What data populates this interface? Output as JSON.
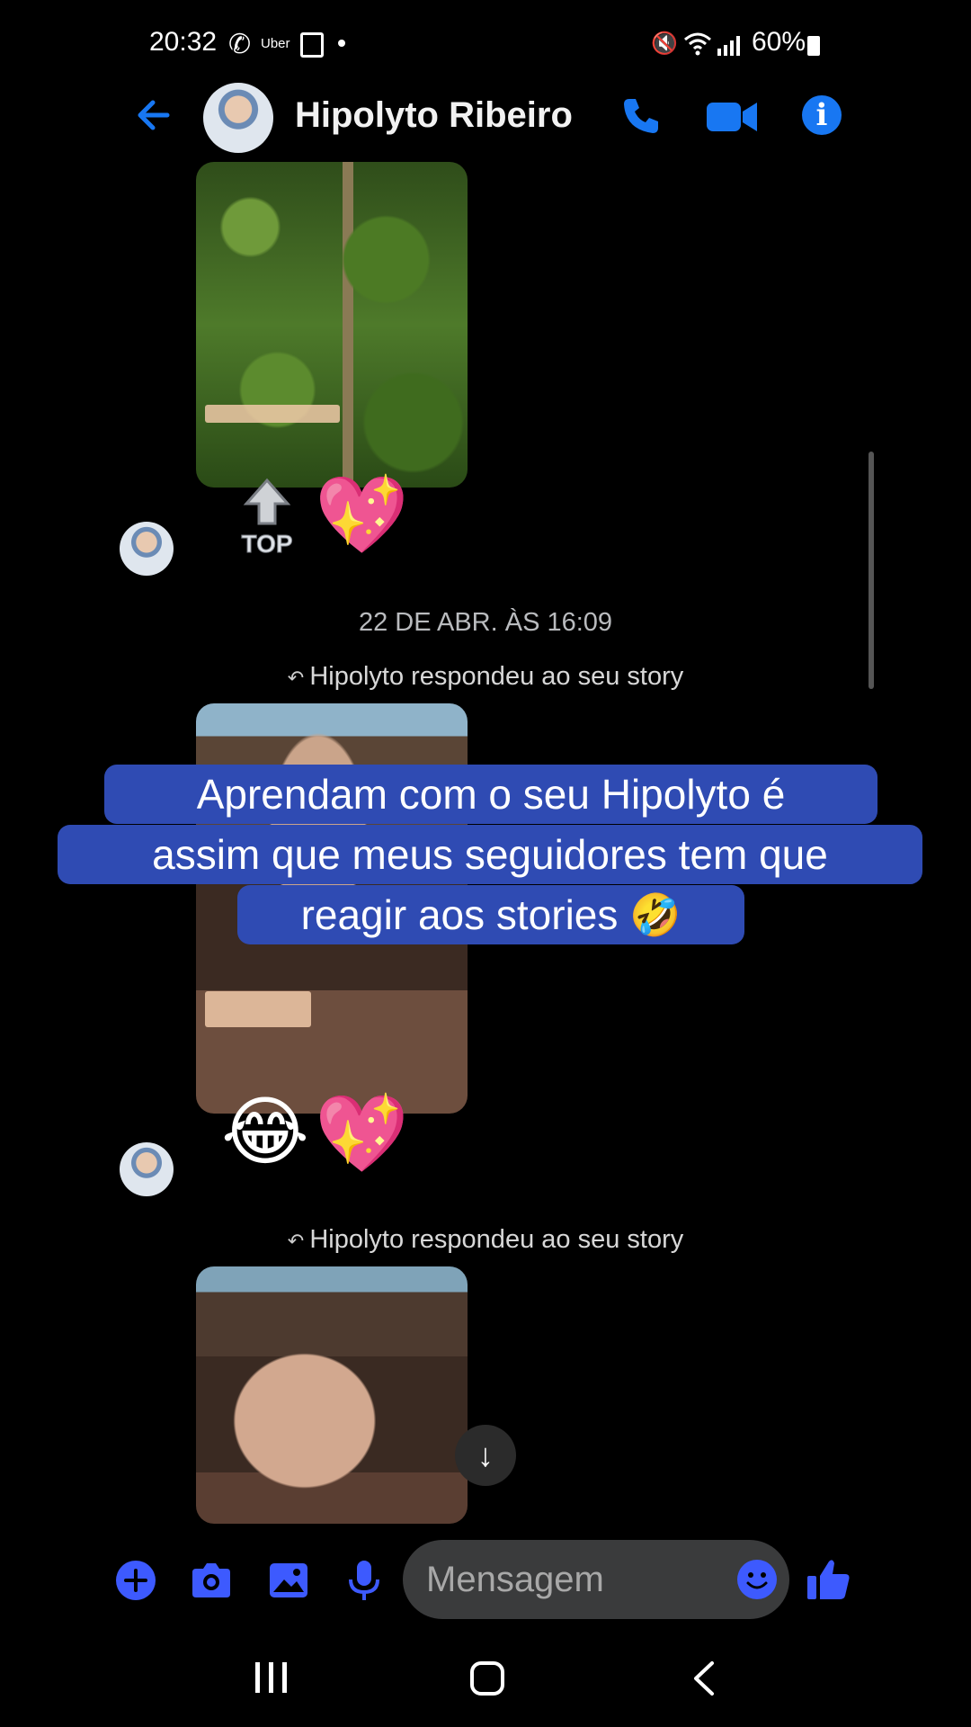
{
  "status_bar": {
    "time": "20:32",
    "uber_label": "Uber",
    "battery": "60%"
  },
  "header": {
    "contact_name": "Hipolyto Ribeiro",
    "accent_color": "#1877f2"
  },
  "chat": {
    "messages": [
      {
        "type": "story-image",
        "sticker": "TOP",
        "reaction": "💖"
      },
      {
        "type": "date-separator",
        "text": "22 DE ABR. ÀS 16:09"
      },
      {
        "type": "story-reply",
        "note": "Hipolyto respondeu ao seu story",
        "reactions": [
          "😂",
          "💖"
        ]
      },
      {
        "type": "story-reply",
        "note": "Hipolyto respondeu ao seu story"
      }
    ]
  },
  "caption": {
    "lines": [
      "Aprendam com o seu Hipolyto é",
      "assim que meus seguidores tem que",
      "reagir aos stories 🤣"
    ],
    "background": "#2f4bb3"
  },
  "composer": {
    "placeholder": "Mensagem"
  },
  "icons": [
    "back-icon",
    "call-icon",
    "video-call-icon",
    "info-icon",
    "plus-icon",
    "camera-icon",
    "gallery-icon",
    "microphone-icon",
    "emoji-icon",
    "thumbs-up-icon",
    "scroll-down-arrow-icon"
  ]
}
